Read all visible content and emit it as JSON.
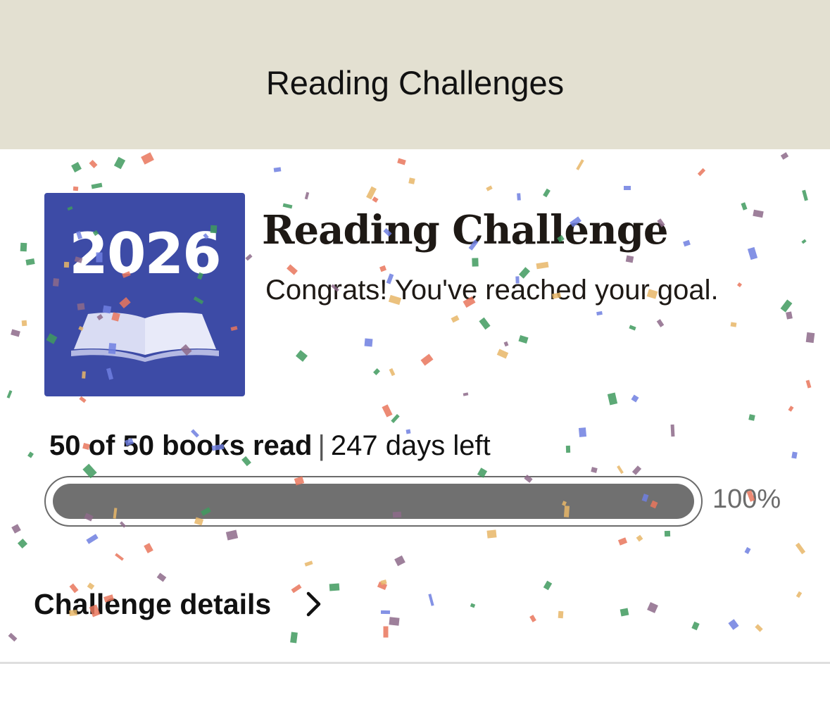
{
  "header": {
    "title": "Reading Challenges"
  },
  "challenge": {
    "cover_year": "2026",
    "title": "Reading Challenge",
    "message": "Congrats! You've reached your goal.",
    "books_read_text": "50 of 50 books read",
    "separator": "|",
    "days_left_text": "247 days left",
    "progress_fraction": 1.0,
    "progress_label": "100%",
    "details_label": "Challenge details"
  },
  "colors": {
    "header_bg": "#e3e0d1",
    "cover_bg": "#3d4ba6",
    "progress_fill": "#707070",
    "confetti": [
      "#3f9a5e",
      "#e8b667",
      "#6f7fe0",
      "#e9765c",
      "#8d6a8a"
    ]
  },
  "icons": {
    "details": "chevron-right-icon",
    "cover": "open-book-icon"
  }
}
